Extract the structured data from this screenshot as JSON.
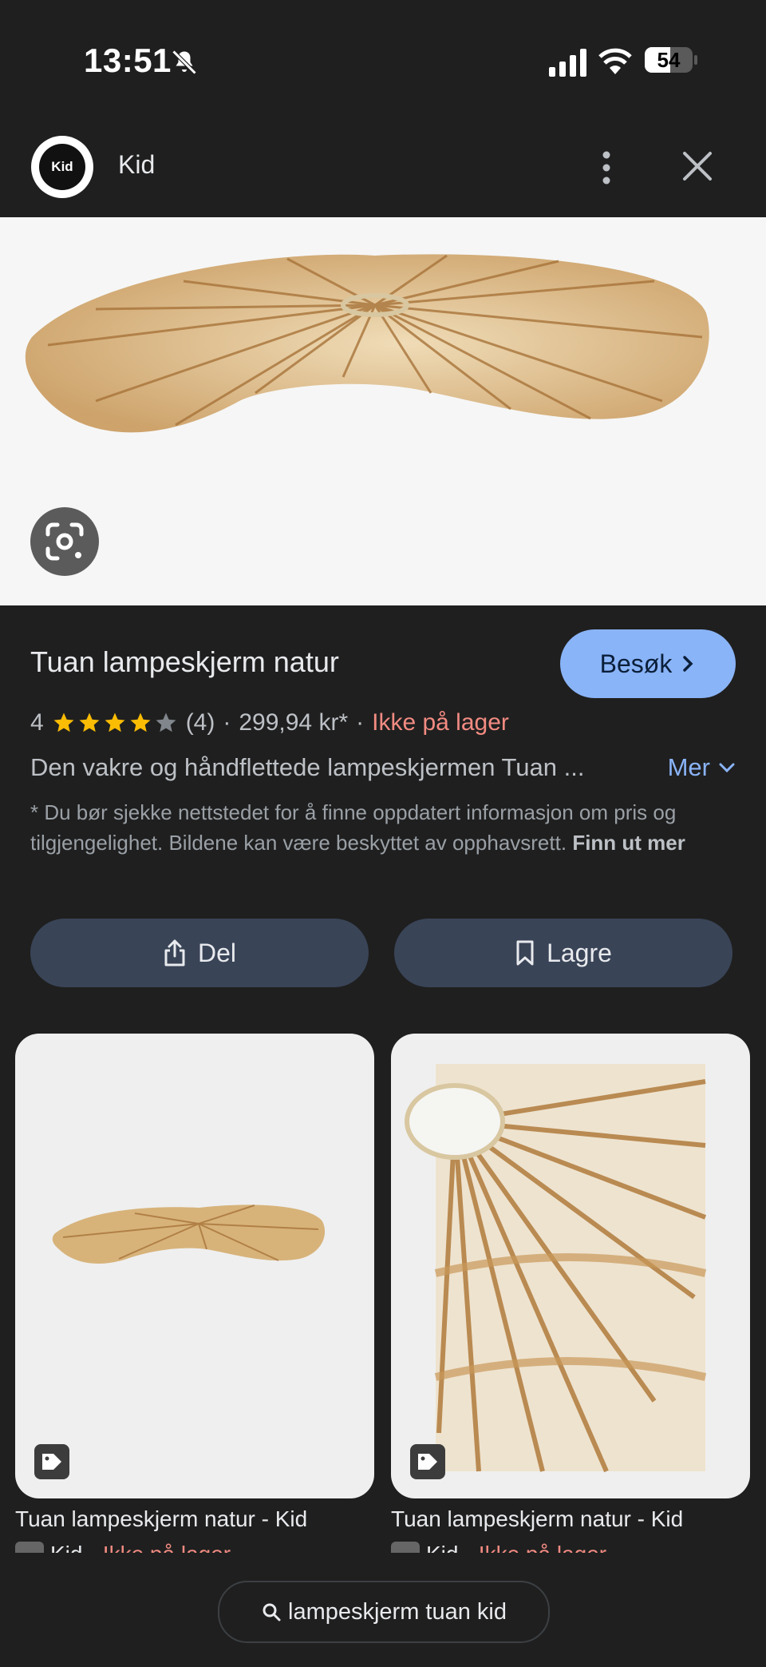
{
  "status": {
    "time": "13:51",
    "battery": "54",
    "battery_level": 0.54
  },
  "app": {
    "logo_text": "Kid",
    "title": "Kid"
  },
  "product": {
    "title": "Tuan lampeskjerm natur",
    "visit_label": "Besøk",
    "rating": "4",
    "rating_stars": 4,
    "review_count": "(4)",
    "price": "299,94 kr*",
    "availability": "Ikke på lager",
    "description": "Den vakre og håndflettede lampeskjermen Tuan ...",
    "more_label": "Mer",
    "disclaimer": "* Du bør sjekke nettstedet for å finne oppdatert informasjon om pris og tilgjengelighet. Bildene kan være beskyttet av opphavsrett.",
    "disclaimer_link": "Finn ut mer",
    "share_label": "Del",
    "save_label": "Lagre"
  },
  "related": [
    {
      "title": "Tuan lampeskjerm natur - Kid",
      "source": "Kid",
      "availability": "Ikke på lager"
    },
    {
      "title": "Tuan lampeskjerm natur - Kid",
      "source": "Kid",
      "availability": "Ikke på lager"
    }
  ],
  "search": {
    "query": "lampeskjerm tuan kid"
  },
  "colors": {
    "accent": "#8ab4f8",
    "out_of_stock": "#f28b82",
    "star": "#fbbc04",
    "pill": "#394457"
  }
}
